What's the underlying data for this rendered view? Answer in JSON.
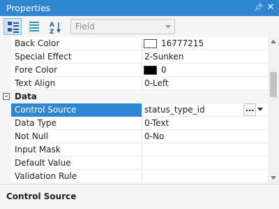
{
  "panel": {
    "title": "Properties",
    "pin_icon": "pin-icon",
    "close_icon": "close-icon"
  },
  "toolbar": {
    "dropdown_value": "Field",
    "icons": [
      "categorized-icon",
      "alphabetical-list-icon",
      "sort-az-icon"
    ]
  },
  "rows": [
    {
      "type": "prop",
      "name": "Back Color",
      "value": "16777215",
      "swatch": "#ffffff"
    },
    {
      "type": "prop",
      "name": "Special Effect",
      "value": "2-Sunken"
    },
    {
      "type": "prop",
      "name": "Fore Color",
      "value": "0",
      "swatch": "#000000"
    },
    {
      "type": "prop",
      "name": "Text Align",
      "value": "0-Left"
    },
    {
      "type": "category",
      "name": "Data"
    },
    {
      "type": "prop",
      "name": "Control Source",
      "value": "status_type_id",
      "selected": true,
      "builder": "...",
      "has_dropdown": true
    },
    {
      "type": "prop",
      "name": "Data Type",
      "value": "0-Text"
    },
    {
      "type": "prop",
      "name": "Not Null",
      "value": "0-No"
    },
    {
      "type": "prop",
      "name": "Input Mask",
      "value": ""
    },
    {
      "type": "prop",
      "name": "Default Value",
      "value": ""
    },
    {
      "type": "prop",
      "name": "Validation Rule",
      "value": ""
    }
  ],
  "description": {
    "title": "Control Source"
  },
  "colors": {
    "accent": "#2f86d3",
    "selection": "#2f86d3"
  }
}
